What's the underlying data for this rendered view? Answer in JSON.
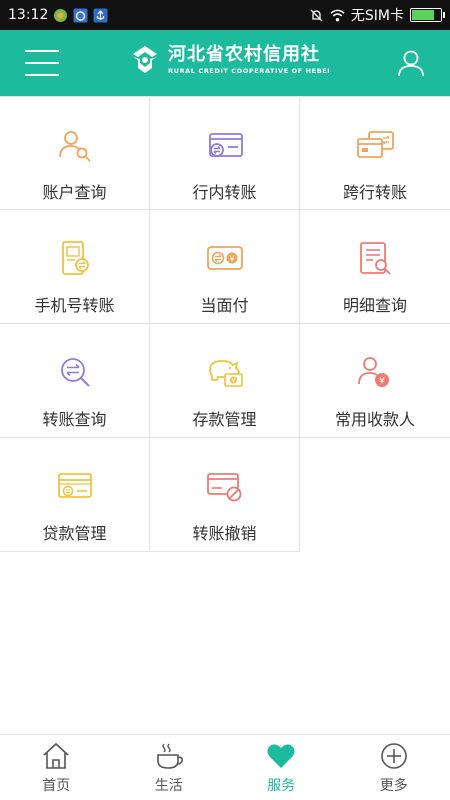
{
  "status_bar": {
    "time": "13:12",
    "carrier": "无SIM卡"
  },
  "header": {
    "brand_cn": "河北省农村信用社",
    "brand_en": "RURAL CREDIT COOPERATIVE OF HEBEI",
    "menu_icon": "hamburger-menu-icon",
    "user_icon": "user-icon",
    "color": "#1dbb9e"
  },
  "grid": {
    "items": [
      {
        "label": "账户查询",
        "icon": "account-search-icon",
        "color": "#f2a35b"
      },
      {
        "label": "行内转账",
        "icon": "card-transfer-icon",
        "color": "#8c7ce0"
      },
      {
        "label": "跨行转账",
        "icon": "interbank-transfer-icon",
        "color": "#f2a35b"
      },
      {
        "label": "手机号转账",
        "icon": "phone-transfer-icon",
        "color": "#f0c23c"
      },
      {
        "label": "当面付",
        "icon": "face-pay-icon",
        "color": "#f2a35b"
      },
      {
        "label": "明细查询",
        "icon": "detail-search-icon",
        "color": "#ee7b73"
      },
      {
        "label": "转账查询",
        "icon": "transfer-search-icon",
        "color": "#8c7ce0"
      },
      {
        "label": "存款管理",
        "icon": "piggy-bank-icon",
        "color": "#f0c23c"
      },
      {
        "label": "常用收款人",
        "icon": "payee-icon",
        "color": "#ee7b73"
      },
      {
        "label": "贷款管理",
        "icon": "loan-card-icon",
        "color": "#f0c23c"
      },
      {
        "label": "转账撤销",
        "icon": "transfer-cancel-icon",
        "color": "#ee7b73"
      }
    ]
  },
  "bottom_nav": {
    "items": [
      {
        "label": "首页",
        "icon": "home-icon"
      },
      {
        "label": "生活",
        "icon": "coffee-cup-icon"
      },
      {
        "label": "服务",
        "icon": "heart-icon",
        "active": true
      },
      {
        "label": "更多",
        "icon": "plus-circle-icon"
      }
    ],
    "active_color": "#1dbb9e"
  }
}
